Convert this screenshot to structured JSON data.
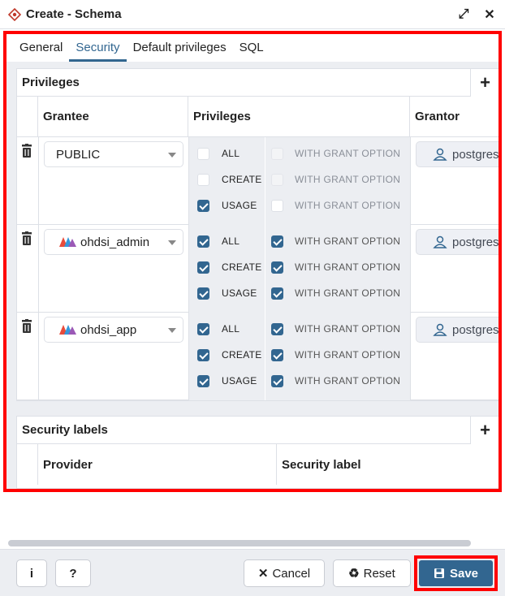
{
  "window": {
    "title": "Create - Schema",
    "expand_glyph": "⤢",
    "close_glyph": "✕"
  },
  "tabs": [
    {
      "label": "General",
      "active": false
    },
    {
      "label": "Security",
      "active": true
    },
    {
      "label": "Default privileges",
      "active": false
    },
    {
      "label": "SQL",
      "active": false
    }
  ],
  "privileges_panel": {
    "title": "Privileges",
    "add_glyph": "+",
    "columns": {
      "grantee": "Grantee",
      "privileges": "Privileges",
      "grantor": "Grantor"
    },
    "rows": [
      {
        "grantee": "PUBLIC",
        "grantee_icon": "",
        "grantor": "postgres",
        "privileges": [
          {
            "name": "ALL",
            "checked": false,
            "grant_label": "WITH GRANT OPTION",
            "grant_checked": false
          },
          {
            "name": "CREATE",
            "checked": false,
            "grant_label": "WITH GRANT OPTION",
            "grant_checked": false
          },
          {
            "name": "USAGE",
            "checked": true,
            "grant_label": "WITH GRANT OPTION",
            "grant_checked": false
          }
        ]
      },
      {
        "grantee": "ohdsi_admin",
        "grantee_icon": "role-icon",
        "grantor": "postgres",
        "privileges": [
          {
            "name": "ALL",
            "checked": true,
            "grant_label": "WITH GRANT OPTION",
            "grant_checked": true
          },
          {
            "name": "CREATE",
            "checked": true,
            "grant_label": "WITH GRANT OPTION",
            "grant_checked": true
          },
          {
            "name": "USAGE",
            "checked": true,
            "grant_label": "WITH GRANT OPTION",
            "grant_checked": true
          }
        ]
      },
      {
        "grantee": "ohdsi_app",
        "grantee_icon": "role-icon",
        "grantor": "postgres",
        "privileges": [
          {
            "name": "ALL",
            "checked": true,
            "grant_label": "WITH GRANT OPTION",
            "grant_checked": true
          },
          {
            "name": "CREATE",
            "checked": true,
            "grant_label": "WITH GRANT OPTION",
            "grant_checked": true
          },
          {
            "name": "USAGE",
            "checked": true,
            "grant_label": "WITH GRANT OPTION",
            "grant_checked": true
          }
        ]
      }
    ]
  },
  "security_labels_panel": {
    "title": "Security labels",
    "add_glyph": "+",
    "columns": {
      "provider": "Provider",
      "security_label": "Security label"
    }
  },
  "footer": {
    "info_label": "i",
    "help_label": "?",
    "cancel_label": "Cancel",
    "cancel_glyph": "✕",
    "reset_label": "Reset",
    "reset_glyph": "♻",
    "save_label": "Save"
  },
  "colors": {
    "accent": "#326690",
    "highlight_box": "#ff0000",
    "panel_bg": "#eceef2"
  }
}
